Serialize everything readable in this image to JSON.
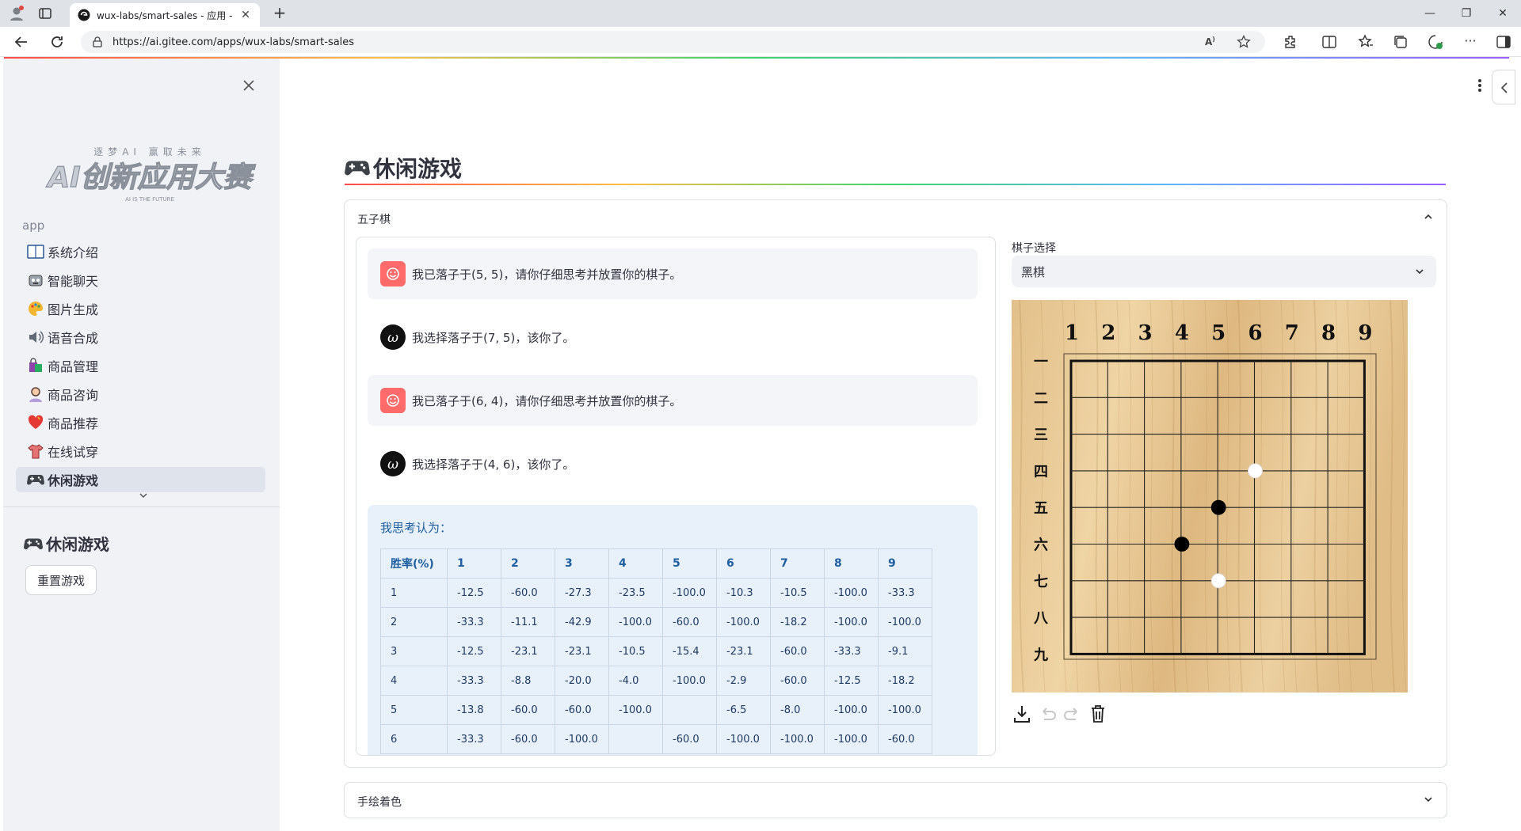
{
  "browser": {
    "tab_title": "wux-labs/smart-sales - 应用 - Gitee",
    "url": "https://ai.gitee.com/apps/wux-labs/smart-sales"
  },
  "sidebar": {
    "logo_text": "AI创新应用大赛",
    "logo_sub": "逐梦AI 赢取未来",
    "logo_tag": "AI IS THE FUTURE",
    "section_label": "app",
    "items": [
      {
        "label": "系统介绍",
        "icon": "book-icon"
      },
      {
        "label": "智能聊天",
        "icon": "robot-icon"
      },
      {
        "label": "图片生成",
        "icon": "palette-icon"
      },
      {
        "label": "语音合成",
        "icon": "speaker-icon"
      },
      {
        "label": "商品管理",
        "icon": "shopping-bags-icon"
      },
      {
        "label": "商品咨询",
        "icon": "person-icon"
      },
      {
        "label": "商品推荐",
        "icon": "heart-icon"
      },
      {
        "label": "在线试穿",
        "icon": "tshirt-icon"
      },
      {
        "label": "休闲游戏",
        "icon": "gamepad-icon"
      }
    ],
    "subtitle": "休闲游戏",
    "reset_button": "重置游戏"
  },
  "main": {
    "title": "休闲游戏",
    "expander1_label": "五子棋",
    "expander2_label": "手绘着色",
    "messages": [
      {
        "role": "user",
        "text": "我已落子于(5, 5)，请你仔细思考并放置你的棋子。"
      },
      {
        "role": "assistant",
        "text": "我选择落子于(7, 5)，该你了。"
      },
      {
        "role": "user",
        "text": "我已落子于(6, 4)，请你仔细思考并放置你的棋子。"
      },
      {
        "role": "assistant",
        "text": "我选择落子于(4, 6)，该你了。"
      }
    ],
    "analysis_title": "我思考认为：",
    "table": {
      "headers": [
        "胜率(%)",
        "1",
        "2",
        "3",
        "4",
        "5",
        "6",
        "7",
        "8",
        "9"
      ],
      "rows": [
        [
          "1",
          "-12.5",
          "-60.0",
          "-27.3",
          "-23.5",
          "-100.0",
          "-10.3",
          "-10.5",
          "-100.0",
          "-33.3"
        ],
        [
          "2",
          "-33.3",
          "-11.1",
          "-42.9",
          "-100.0",
          "-60.0",
          "-100.0",
          "-18.2",
          "-100.0",
          "-100.0"
        ],
        [
          "3",
          "-12.5",
          "-23.1",
          "-23.1",
          "-10.5",
          "-15.4",
          "-23.1",
          "-60.0",
          "-33.3",
          "-9.1"
        ],
        [
          "4",
          "-33.3",
          "-8.8",
          "-20.0",
          "-4.0",
          "-100.0",
          "-2.9",
          "-60.0",
          "-12.5",
          "-18.2"
        ],
        [
          "5",
          "-13.8",
          "-60.0",
          "-60.0",
          "-100.0",
          "",
          "-6.5",
          "-8.0",
          "-100.0",
          "-100.0"
        ],
        [
          "6",
          "-33.3",
          "-60.0",
          "-100.0",
          "",
          "-60.0",
          "-100.0",
          "-100.0",
          "-100.0",
          "-60.0"
        ]
      ]
    },
    "select_label": "棋子选择",
    "select_value": "黑棋",
    "board": {
      "col_labels": [
        "1",
        "2",
        "3",
        "4",
        "5",
        "6",
        "7",
        "8",
        "9"
      ],
      "row_labels": [
        "一",
        "二",
        "三",
        "四",
        "五",
        "六",
        "七",
        "八",
        "九"
      ],
      "stones": [
        {
          "col": 6,
          "row": 4,
          "color": "white"
        },
        {
          "col": 5,
          "row": 5,
          "color": "black"
        },
        {
          "col": 4,
          "row": 6,
          "color": "black"
        },
        {
          "col": 5,
          "row": 7,
          "color": "white"
        }
      ]
    }
  }
}
